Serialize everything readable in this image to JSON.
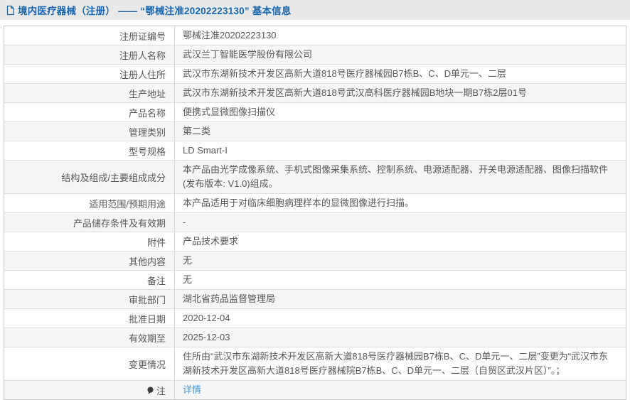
{
  "header": {
    "title": "境内医疗器械（注册） —— “鄂械注准20202223130” 基本信息"
  },
  "colors": {
    "title_blue": "#1765ad",
    "link_blue": "#4496d4",
    "row_alt_bg": "#f6f6f7",
    "text_gray": "#575757"
  },
  "icons": {
    "document_icon": "document-icon",
    "note_icon": "speech-balloon-icon"
  },
  "table": {
    "rows": [
      {
        "label": "注册证编号",
        "value": "鄂械注准20202223130"
      },
      {
        "label": "注册人名称",
        "value": "武汉兰丁智能医学股份有限公司"
      },
      {
        "label": "注册人住所",
        "value": "武汉市东湖新技术开发区高新大道818号医疗器械园B7栋B、C、D单元一、二层"
      },
      {
        "label": "生产地址",
        "value": "武汉市东湖新技术开发区高新大道818号武汉高科医疗器械园B地块一期B7栋2层01号"
      },
      {
        "label": "产品名称",
        "value": "便携式显微图像扫描仪"
      },
      {
        "label": "管理类别",
        "value": "第二类"
      },
      {
        "label": "型号规格",
        "value": "LD Smart-I"
      },
      {
        "label": "结构及组成/主要组成成分",
        "value": "本产品由光学成像系统、手机式图像采集系统、控制系统、电源适配器、开关电源适配器、图像扫描软件(发布版本: V1.0)组成。"
      },
      {
        "label": "适用范围/预期用途",
        "value": "本产品适用于对临床细胞病理样本的显微图像进行扫描。"
      },
      {
        "label": "产品储存条件及有效期",
        "value": "-"
      },
      {
        "label": "附件",
        "value": "产品技术要求"
      },
      {
        "label": "其他内容",
        "value": "无"
      },
      {
        "label": "备注",
        "value": "无"
      },
      {
        "label": "审批部门",
        "value": "湖北省药品监督管理局"
      },
      {
        "label": "批准日期",
        "value": "2020-12-04"
      },
      {
        "label": "有效期至",
        "value": "2025-12-03"
      },
      {
        "label": "变更情况",
        "value": "住所由“武汉市东湖新技术开发区高新大道818号医疗器械园B7栋B、C、D单元一、二层”变更为“武汉市东湖新技术开发区高新大道818号医疗器械院B7栋B、C、D单元一、二层（自贸区武汉片区）”。；"
      },
      {
        "label": "注",
        "value": "详情"
      }
    ]
  }
}
